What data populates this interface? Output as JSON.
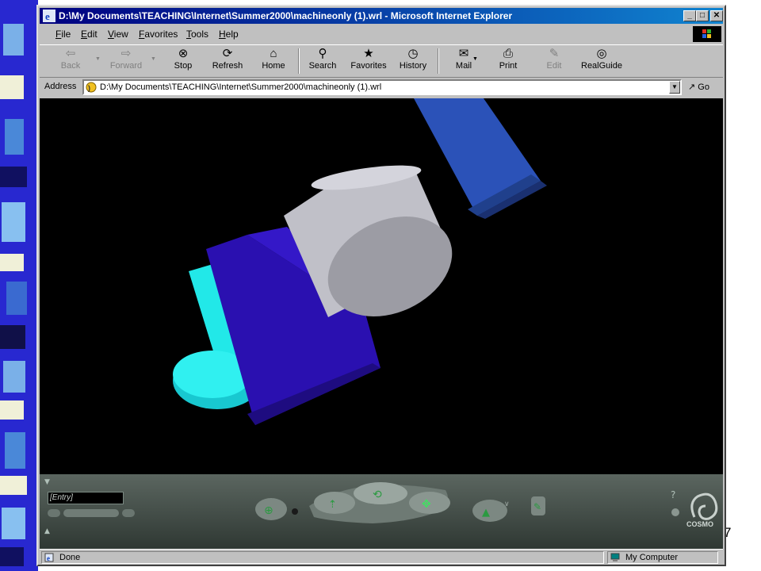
{
  "window": {
    "title": "D:\\My Documents\\TEACHING\\Internet\\Summer2000\\machineonly (1).wrl - Microsoft Internet Explorer"
  },
  "menu": [
    "File",
    "Edit",
    "View",
    "Favorites",
    "Tools",
    "Help"
  ],
  "toolbar": {
    "back": "Back",
    "forward": "Forward",
    "stop": "Stop",
    "refresh": "Refresh",
    "home": "Home",
    "search": "Search",
    "favorites": "Favorites",
    "history": "History",
    "mail": "Mail",
    "print": "Print",
    "edit": "Edit",
    "realguide": "RealGuide"
  },
  "address": {
    "label": "Address",
    "url": "D:\\My Documents\\TEACHING\\Internet\\Summer2000\\machineonly (1).wrl",
    "go": "Go"
  },
  "viewer": {
    "entry": "[Entry]",
    "brand": "COSMO"
  },
  "status": {
    "text": "Done",
    "zone": "My Computer"
  },
  "slide": {
    "page_number": "7"
  },
  "colors": {
    "titlebar": "#000080",
    "viewport_background": "#000000",
    "cyan_part": "#1fe0e0",
    "blue_block": "#2a10b4",
    "gray_cylinder": "#b8b8c0",
    "blue_beam": "#2850b0"
  }
}
